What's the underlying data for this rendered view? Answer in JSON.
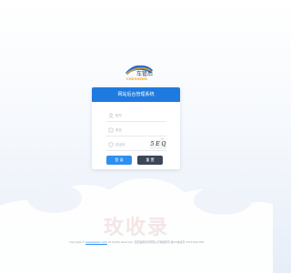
{
  "logo": {
    "text": "车管后",
    "subtext": "CHESHENG"
  },
  "login": {
    "title": "网站后台管理系统",
    "username_placeholder": "账号",
    "role_placeholder": "角色",
    "captcha_placeholder": "验证码",
    "captcha_code": "5 E Q",
    "login_button": "登 录",
    "reset_button": "重 置"
  },
  "footer": {
    "prefix": "Copyright ©",
    "link": "www.peixun.com",
    "text": "All Rights Reserved. 百度贴吧访问有限公司版权所有 皖ICP备案号 0551-000-000"
  },
  "watermark": {
    "text": "玫收录"
  },
  "colors": {
    "header_blue": "#1f7ae0",
    "login_btn": "#2f8ff0",
    "reset_btn": "#3b4757"
  }
}
